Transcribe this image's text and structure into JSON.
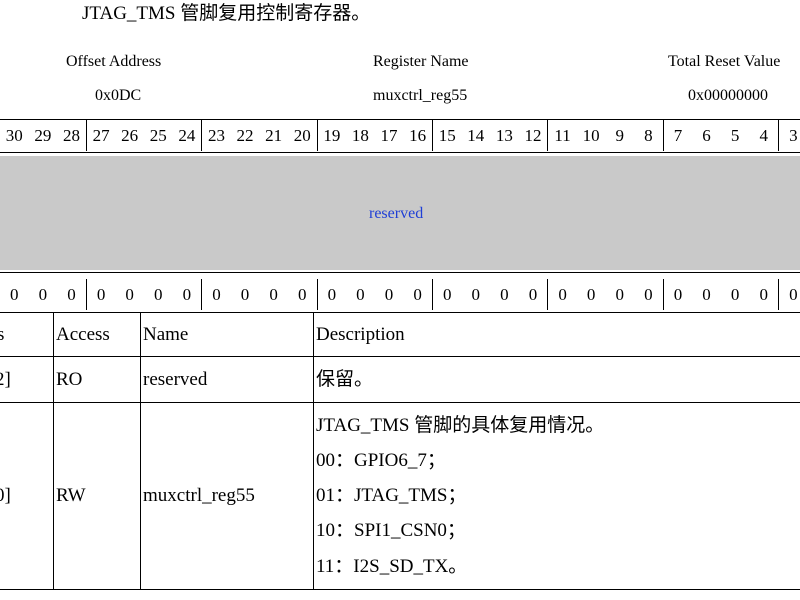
{
  "heading": "JTAG_TMS 管脚复用控制寄存器。",
  "register": {
    "offset_label": "Offset Address",
    "offset_value": "0x0DC",
    "name_label": "Register Name",
    "name_value": "muxctrl_reg55",
    "reset_label": "Total Reset Value",
    "reset_value": "0x00000000"
  },
  "bit_numbers": [
    "30",
    "29",
    "28",
    "27",
    "26",
    "25",
    "24",
    "23",
    "22",
    "21",
    "20",
    "19",
    "18",
    "17",
    "16",
    "15",
    "14",
    "13",
    "12",
    "11",
    "10",
    "9",
    "8",
    "7",
    "6",
    "5",
    "4",
    "3"
  ],
  "reserved_label": "reserved",
  "reset_bits": [
    "0",
    "0",
    "0",
    "0",
    "0",
    "0",
    "0",
    "0",
    "0",
    "0",
    "0",
    "0",
    "0",
    "0",
    "0",
    "0",
    "0",
    "0",
    "0",
    "0",
    "0",
    "0",
    "0",
    "0",
    "0",
    "0",
    "0",
    "0"
  ],
  "table": {
    "headers": [
      "s",
      "Access",
      "Name",
      "Description"
    ],
    "rows": [
      {
        "bits": "2]",
        "access": "RO",
        "name": "reserved",
        "description": [
          "保留。"
        ]
      },
      {
        "bits": "0]",
        "access": "RW",
        "name": "muxctrl_reg55",
        "description": [
          "JTAG_TMS 管脚的具体复用情况。",
          "00：GPIO6_7；",
          "01：JTAG_TMS；",
          "10：SPI1_CSN0；",
          "11：I2S_SD_TX。"
        ]
      }
    ]
  }
}
